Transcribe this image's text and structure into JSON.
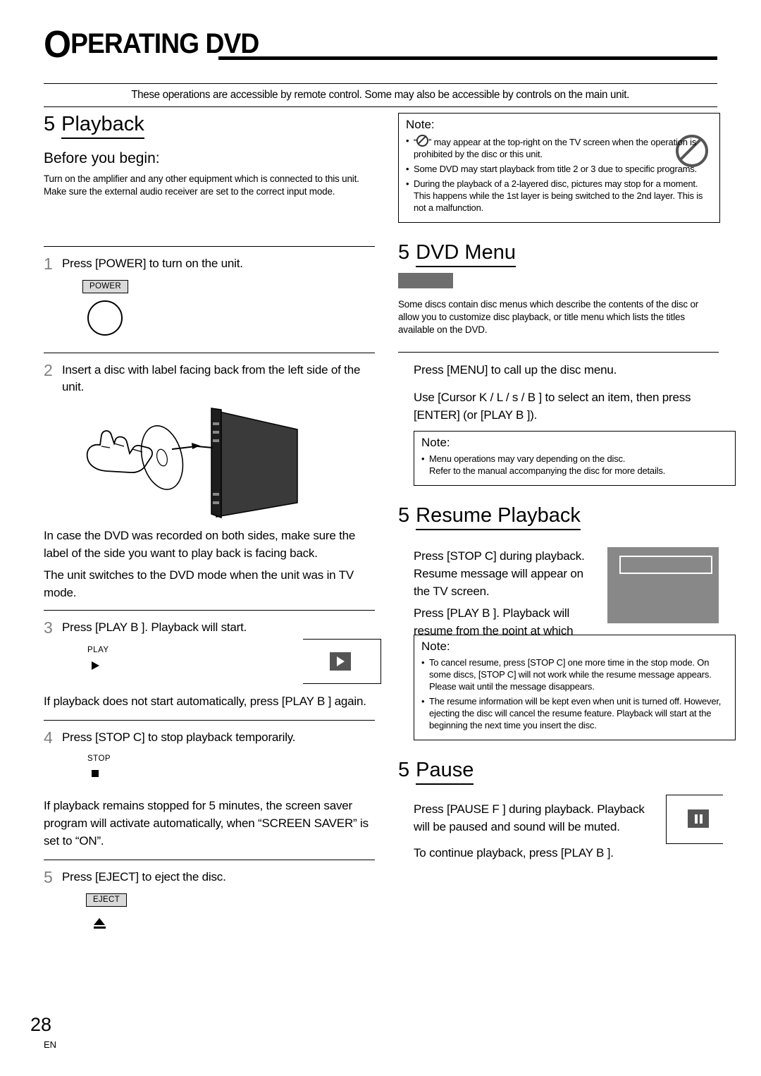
{
  "header": {
    "chapter_first_letter": "O",
    "chapter_rest": "PERATING DVD",
    "banner": "These operations are accessible by remote control.  Some may also be accessible by controls on the main unit."
  },
  "left": {
    "playback": {
      "number": "5",
      "title": "Playback",
      "before_heading": "Before you begin:",
      "before_text": "Turn on the amplifier and any other equipment which is connected to this unit. Make sure the external audio receiver are set to the correct input mode.",
      "steps": [
        {
          "num": "1",
          "text": "Press [POWER] to turn on the unit.",
          "keycap": "POWER"
        },
        {
          "num": "2",
          "text": "Insert a disc with label facing back from the left side of the unit.",
          "after_1": "In case the DVD was recorded on both sides, make sure the label of the side you want to play back is facing back.",
          "after_2": "The unit switches to the DVD mode when the unit was in TV mode."
        },
        {
          "num": "3",
          "text": "Press [PLAY B ]. Playback will start.",
          "keylabel": "PLAY",
          "after_1": "If playback does not start automatically, press [PLAY B ] again."
        },
        {
          "num": "4",
          "text": "Press [STOP C] to stop playback temporarily.",
          "keylabel": "STOP",
          "after_1": "If playback remains stopped for 5 minutes, the screen saver program will activate automatically, when “SCREEN SAVER” is set to “ON”."
        },
        {
          "num": "5",
          "text": "Press [EJECT] to eject the disc.",
          "keycap": "EJECT"
        }
      ]
    }
  },
  "right": {
    "note_top": {
      "title": "Note:",
      "items": [
        "“  ” may appear at the top-right on the TV screen when the operation is prohibited by the disc or this unit.",
        "Some DVD may start playback from title 2 or 3 due to specific programs.",
        "During the playback of a 2-layered disc, pictures may stop for a moment. This happens while the 1st layer is being switched to the 2nd layer. This is not a malfunction."
      ]
    },
    "dvd_menu": {
      "number": "5",
      "title": "DVD Menu",
      "intro": "Some discs contain disc menus which describe the contents of the disc or allow you to customize disc playback, or title menu which lists the titles available on the DVD.",
      "line_1": "Press [MENU] to call up the disc menu.",
      "line_2": "Use [Cursor K / L / s / B ] to select an item, then press [ENTER] (or [PLAY B ]).",
      "note": {
        "title": "Note:",
        "items": [
          "Menu operations may vary depending on the disc.",
          "Refer to the manual accompanying the disc for more details."
        ]
      }
    },
    "resume": {
      "number": "5",
      "title": "Resume Playback",
      "line_1": "Press [STOP C] during playback. Resume message will appear on the TV screen.",
      "line_2": "Press [PLAY B ]. Playback will resume from the point at which playback was stopped.",
      "note": {
        "title": "Note:",
        "items": [
          "To cancel resume, press [STOP C] one more time in the stop mode. On some discs, [STOP C] will not work while the resume message appears. Please wait until the message disappears.",
          "The resume information will be kept even when unit is turned off. However, ejecting the disc will cancel the resume feature. Playback will start at the beginning the next time you insert the disc."
        ]
      }
    },
    "pause": {
      "number": "5",
      "title": "Pause",
      "line_1": "Press [PAUSE F ] during playback. Playback will be paused and sound will be muted.",
      "line_2": "To continue playback, press [PLAY B ]."
    }
  },
  "footer": {
    "page_number": "28",
    "lang": "EN"
  }
}
